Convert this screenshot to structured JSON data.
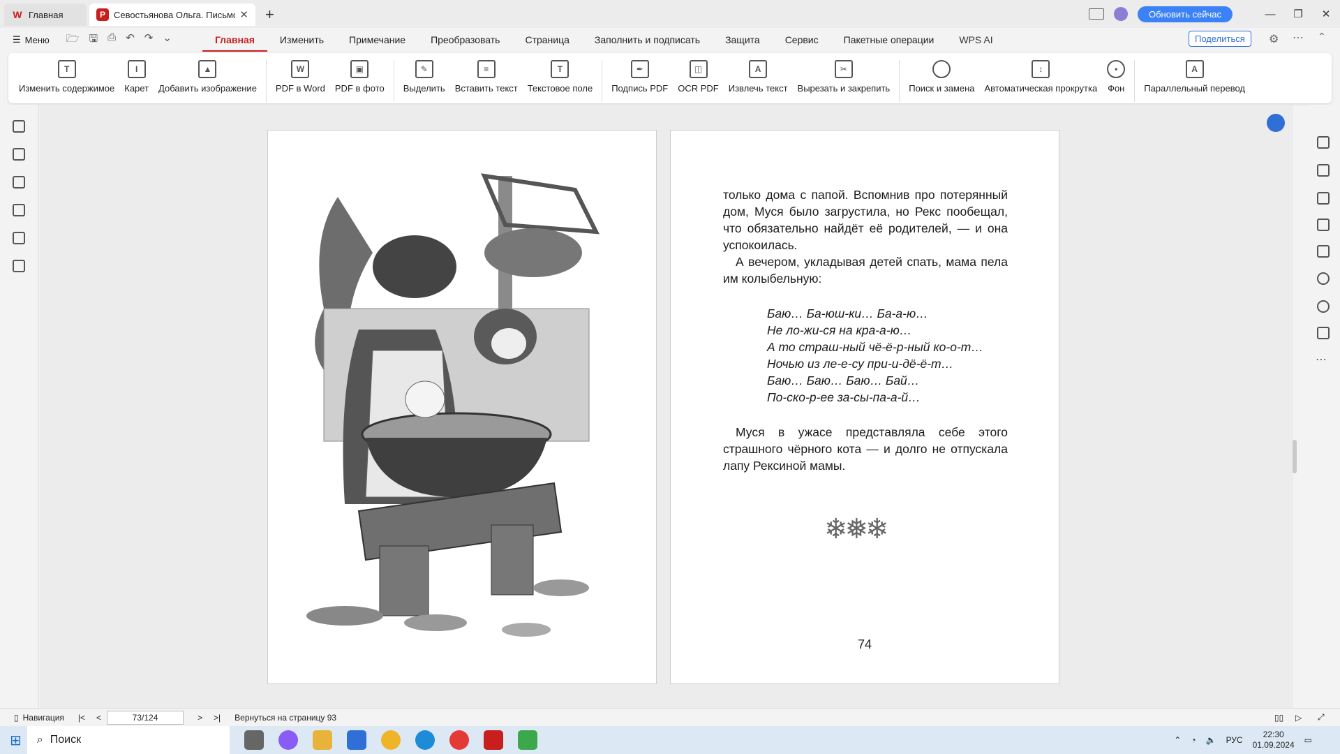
{
  "tabs": [
    {
      "label": "Главная"
    },
    {
      "label": "Севостьянова Ольга. Письмо"
    }
  ],
  "titlebar": {
    "upgrade": "Обновить сейчас"
  },
  "menu": {
    "menu_label": "Меню",
    "tabs": [
      "Главная",
      "Изменить",
      "Примечание",
      "Преобразовать",
      "Страница",
      "Заполнить и подписать",
      "Защита",
      "Сервис",
      "Пакетные операции",
      "WPS AI"
    ],
    "share": "Поделиться"
  },
  "toolbar": {
    "items": [
      "Изменить содержимое",
      "Карет",
      "Добавить изображение",
      "PDF в Word",
      "PDF в фото",
      "Выделить",
      "Вставить текст",
      "Текстовое поле",
      "Подпись PDF",
      "OCR PDF",
      "Извлечь текст",
      "Вырезать и закрепить",
      "Поиск и замена",
      "Автоматическая прокрутка",
      "Фон",
      "Параллельный перевод"
    ]
  },
  "document": {
    "lines_intro": "только дома с папой. Вспомнив про потерянный дом, Муся было загрустила, но Рекс пообещал, что обязательно найдёт её родителей, — и она успокоилась.",
    "lines_evening": "А вечером, укладывая детей спать, мама пела им колыбельную:",
    "poem": [
      "Баю… Ба-юш-ки… Ба-а-ю…",
      "Не ло-жи-ся на кра-а-ю…",
      "А то страш-ный чё-ё-р-ный ко-о-т…",
      "Ночью из ле-е-су при-и-дё-ё-т…",
      "Баю… Баю… Баю… Бай…",
      "По-ско-р-ее за-сы-па-а-й…"
    ],
    "lines_end": "Муся в ужасе представляла себе этого страшного чёрного кота — и долго не отпускала лапу Рексиной мамы.",
    "flakes": "❄❅❄",
    "page_number": "74"
  },
  "status": {
    "navigation": "Навигация",
    "page_box": "73/124",
    "return": "Вернуться на страницу 93"
  },
  "taskbar": {
    "search": "Поиск",
    "lang": "РУС",
    "time": "22:30",
    "date": "01.09.2024"
  }
}
